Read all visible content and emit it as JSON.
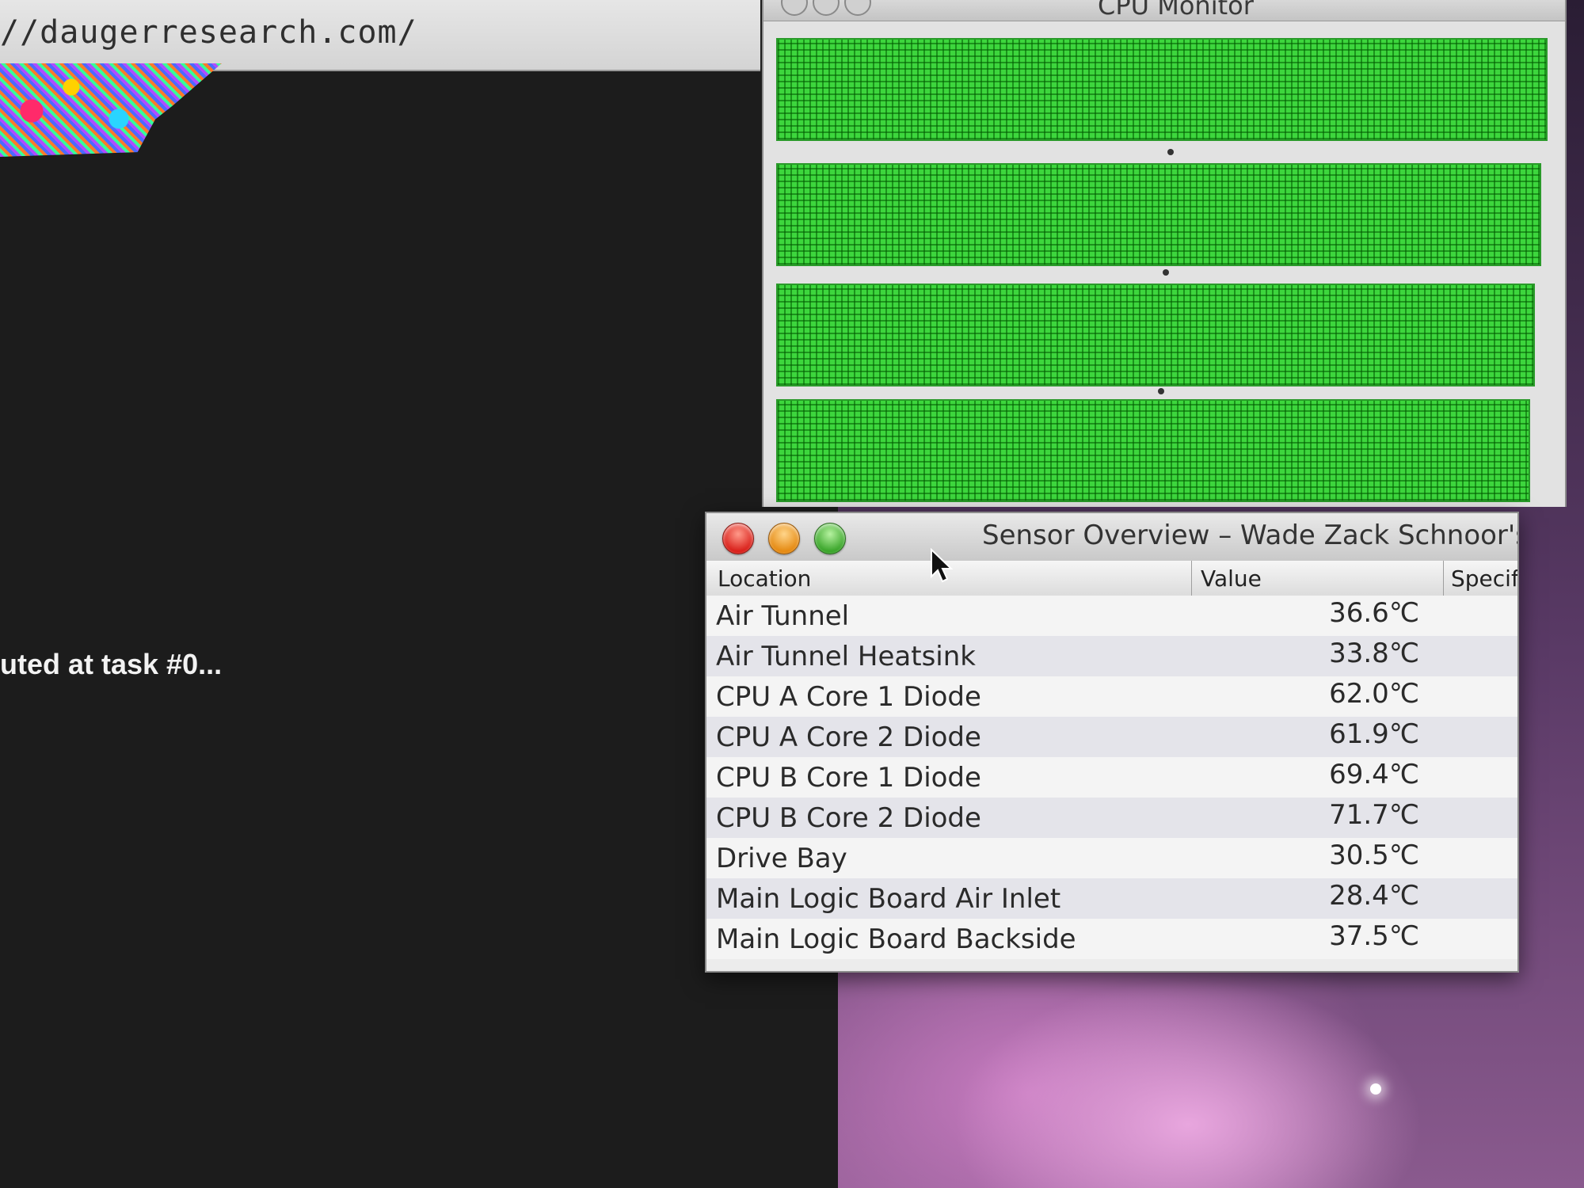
{
  "browser": {
    "url": "//daugerresearch.com/"
  },
  "terminal": {
    "line": "uted at task #0..."
  },
  "cpu_monitor": {
    "title": "CPU Monitor",
    "cores": [
      {
        "load_fraction": 1.0
      },
      {
        "load_fraction": 1.0
      },
      {
        "load_fraction": 1.0
      },
      {
        "load_fraction": 1.0
      }
    ],
    "bar_color": "#3dd63d"
  },
  "sensor_window": {
    "title": "Sensor Overview – Wade Zack Schnoor's",
    "columns": {
      "location": "Location",
      "value": "Value",
      "specified": "Specifie"
    },
    "rows": [
      {
        "location": "Air Tunnel",
        "value": "36.6℃"
      },
      {
        "location": "Air Tunnel Heatsink",
        "value": "33.8℃"
      },
      {
        "location": "CPU A Core 1 Diode",
        "value": "62.0℃"
      },
      {
        "location": "CPU A Core 2 Diode",
        "value": "61.9℃"
      },
      {
        "location": "CPU B Core 1 Diode",
        "value": "69.4℃"
      },
      {
        "location": "CPU B Core 2 Diode",
        "value": "71.7℃"
      },
      {
        "location": "Drive Bay",
        "value": "30.5℃"
      },
      {
        "location": "Main Logic Board Air Inlet",
        "value": "28.4℃"
      },
      {
        "location": "Main Logic Board Backside",
        "value": "37.5℃"
      }
    ]
  },
  "icons": {
    "close": "close-button",
    "minimize": "minimize-button",
    "zoom": "zoom-button",
    "cursor": "mouse-pointer-icon"
  }
}
